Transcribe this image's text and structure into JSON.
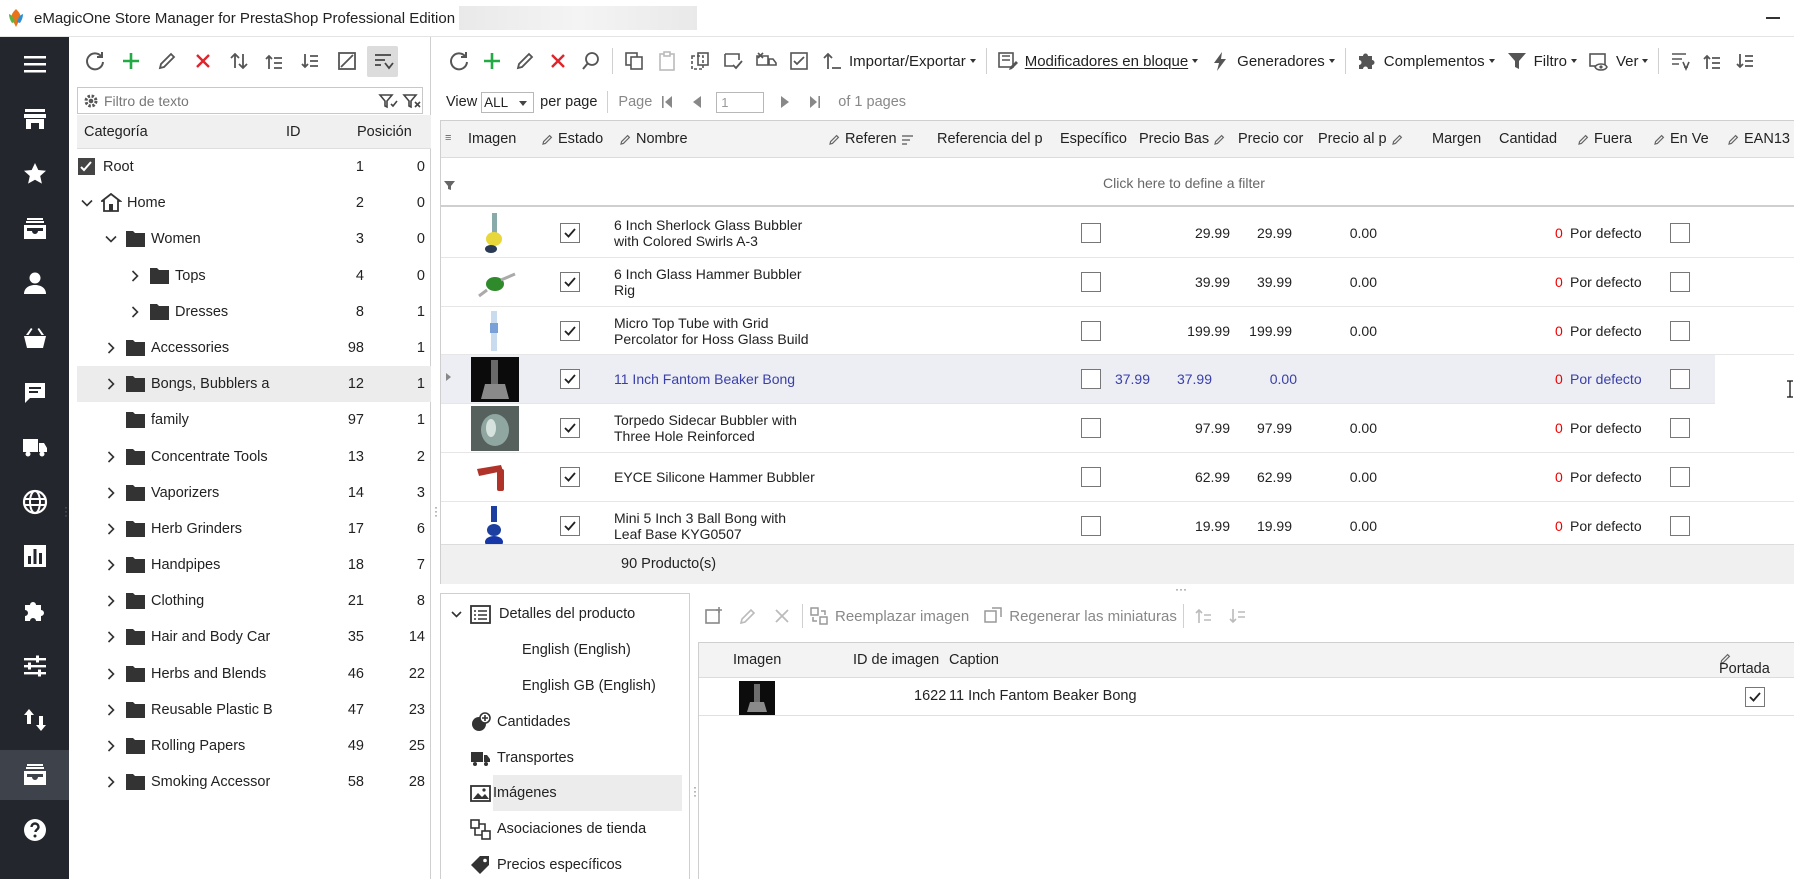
{
  "window": {
    "title": "eMagicOne Store Manager for PrestaShop Professional Edition"
  },
  "colors": {
    "nav_bg": "#23262d",
    "accent_green": "#22aa44",
    "accent_red": "#e0242c",
    "qty_red": "#e00000",
    "selected_text": "#3a3fa8"
  },
  "leftnav": {
    "items": [
      {
        "icon": "menu-icon"
      },
      {
        "icon": "store-icon"
      },
      {
        "icon": "star-icon"
      },
      {
        "icon": "inbox-icon"
      },
      {
        "icon": "user-icon"
      },
      {
        "icon": "basket-icon"
      },
      {
        "icon": "message-icon"
      },
      {
        "icon": "truck-icon"
      },
      {
        "icon": "globe-icon"
      },
      {
        "icon": "chart-icon"
      },
      {
        "icon": "puzzle-icon"
      },
      {
        "icon": "sliders-icon"
      },
      {
        "icon": "sync-arrows-icon"
      },
      {
        "icon": "products-icon"
      },
      {
        "icon": "help-icon"
      }
    ]
  },
  "categories": {
    "filter_placeholder": "Filtro de texto",
    "headers": {
      "category": "Categoría",
      "id": "ID",
      "position": "Posición"
    },
    "rows": [
      {
        "name": "Root",
        "id": "1",
        "pos": "0"
      },
      {
        "name": "Home",
        "id": "2",
        "pos": "0"
      },
      {
        "name": "Women",
        "id": "3",
        "pos": "0"
      },
      {
        "name": "Tops",
        "id": "4",
        "pos": "0"
      },
      {
        "name": "Dresses",
        "id": "8",
        "pos": "1"
      },
      {
        "name": "Accessories",
        "id": "98",
        "pos": "1"
      },
      {
        "name": "Bongs, Bubblers a",
        "id": "12",
        "pos": "1"
      },
      {
        "name": "family",
        "id": "97",
        "pos": "1"
      },
      {
        "name": "Concentrate Tools",
        "id": "13",
        "pos": "2"
      },
      {
        "name": "Vaporizers",
        "id": "14",
        "pos": "3"
      },
      {
        "name": "Herb Grinders",
        "id": "17",
        "pos": "6"
      },
      {
        "name": "Handpipes",
        "id": "18",
        "pos": "7"
      },
      {
        "name": "Clothing",
        "id": "21",
        "pos": "8"
      },
      {
        "name": "Hair and Body Car",
        "id": "35",
        "pos": "14"
      },
      {
        "name": "Herbs and Blends",
        "id": "46",
        "pos": "22"
      },
      {
        "name": "Reusable Plastic B",
        "id": "47",
        "pos": "23"
      },
      {
        "name": "Rolling Papers",
        "id": "49",
        "pos": "25"
      },
      {
        "name": "Smoking Accessor",
        "id": "58",
        "pos": "28"
      }
    ]
  },
  "toolbar": {
    "importar": "Importar/Exportar",
    "modificadores": "Modificadores en bloque",
    "generadores": "Generadores",
    "complementos": "Complementos",
    "filtro": "Filtro",
    "ver": "Ver"
  },
  "paging": {
    "view_label": "View",
    "view_value": "ALL",
    "per_page": "per page",
    "page_label": "Page",
    "page_value": "1",
    "of_pages": "of 1 pages"
  },
  "grid": {
    "headers": {
      "imagen": "Imagen",
      "estado": "Estado",
      "nombre": "Nombre",
      "referen": "Referen",
      "referencia": "Referencia del p",
      "especifico": "Específico",
      "precio_base": "Precio Bas",
      "precio_con": "Precio cor",
      "precio_al": "Precio al p",
      "margen": "Margen",
      "cantidad": "Cantidad",
      "fuera": "Fuera",
      "en_venta": "En Ve",
      "ean": "EAN13"
    },
    "filter_hint": "Click here to define a filter",
    "rows": [
      {
        "name1": "6 Inch Sherlock Glass Bubbler",
        "name2": "with Colored Swirls A-3",
        "base": "29.99",
        "con": "29.99",
        "al": "0.00",
        "qty": "0",
        "fuera": "Por defecto"
      },
      {
        "name1": "6 Inch Glass Hammer Bubbler",
        "name2": "Rig",
        "base": "39.99",
        "con": "39.99",
        "al": "0.00",
        "qty": "0",
        "fuera": "Por defecto"
      },
      {
        "name1": "Micro Top Tube with Grid",
        "name2": "Percolator for Hoss Glass Build",
        "base": "199.99",
        "con": "199.99",
        "al": "0.00",
        "qty": "0",
        "fuera": "Por defecto"
      },
      {
        "name1": "11 Inch Fantom Beaker Bong",
        "name2": "",
        "base": "37.99",
        "con": "37.99",
        "al": "0.00",
        "qty": "0",
        "fuera": "Por defecto"
      },
      {
        "name1": "Torpedo Sidecar Bubbler with",
        "name2": "Three Hole Reinforced",
        "base": "97.99",
        "con": "97.99",
        "al": "0.00",
        "qty": "0",
        "fuera": "Por defecto"
      },
      {
        "name1": "EYCE Silicone Hammer Bubbler",
        "name2": "",
        "base": "62.99",
        "con": "62.99",
        "al": "0.00",
        "qty": "0",
        "fuera": "Por defecto"
      },
      {
        "name1": "Mini 5 Inch 3 Ball Bong with",
        "name2": "Leaf Base  KYG0507",
        "base": "19.99",
        "con": "19.99",
        "al": "0.00",
        "qty": "0",
        "fuera": "Por defecto"
      }
    ],
    "footer": "90 Producto(s)"
  },
  "details": {
    "items": [
      {
        "label": "Detalles del producto",
        "icon": "list-icon"
      },
      {
        "label": "English (English)"
      },
      {
        "label": "English GB (English)"
      },
      {
        "label": "Cantidades",
        "icon": "quantity-icon"
      },
      {
        "label": "Transportes",
        "icon": "truck-icon"
      },
      {
        "label": "Imágenes",
        "icon": "image-icon"
      },
      {
        "label": "Asociaciones de tienda",
        "icon": "shop-assoc-icon"
      },
      {
        "label": "Precios específicos",
        "icon": "tag-icon"
      }
    ]
  },
  "images": {
    "toolbar": {
      "replace": "Reemplazar imagen",
      "regenerate": "Regenerar las miniaturas"
    },
    "headers": {
      "imagen": "Imagen",
      "id": "ID de imagen",
      "caption": "Caption",
      "portada": "Portada"
    },
    "rows": [
      {
        "id": "1622",
        "caption": "11 Inch Fantom Beaker Bong",
        "cover": true
      }
    ]
  }
}
